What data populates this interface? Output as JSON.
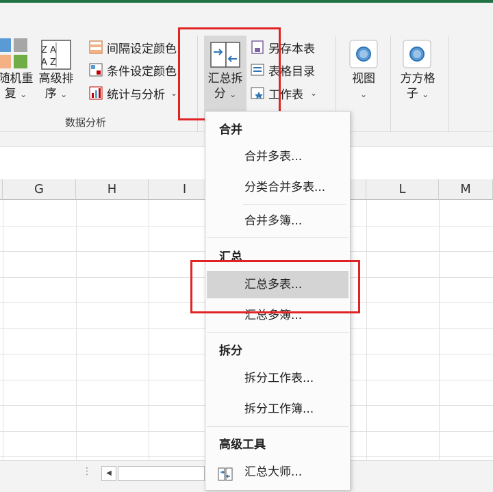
{
  "ribbon": {
    "random_label_1": "随机重",
    "random_label_2": "复",
    "sort_label_1": "高级排",
    "sort_label_2": "序",
    "interval_color": "间隔设定颜色",
    "condition_color": "条件设定颜色",
    "stats_analysis": "统计与分析",
    "group_data_analysis": "数据分析",
    "merge_split_1": "汇总拆",
    "merge_split_2": "分",
    "save_sheet": "另存本表",
    "table_dir": "表格目录",
    "worksheet": "工作表",
    "view": "视图",
    "grid_1": "方方格",
    "grid_2": "子",
    "chevron": "⌄",
    "sort_glyph_top": "Z A",
    "sort_glyph_bottom": "A Z"
  },
  "sheet": {
    "columns": [
      "G",
      "H",
      "I",
      "L",
      "M"
    ]
  },
  "menu": {
    "sec_merge": "合并",
    "merge_multi_table": "合并多表...",
    "classify_merge": "分类合并多表...",
    "merge_multi_book": "合并多簿...",
    "sec_summary": "汇总",
    "summary_multi_table": "汇总多表...",
    "summary_multi_book": "汇总多簿...",
    "sec_split": "拆分",
    "split_sheet": "拆分工作表...",
    "split_book": "拆分工作簿...",
    "sec_advanced": "高级工具",
    "summary_master": "汇总大师..."
  },
  "colors": {
    "accent_green": "#217346",
    "highlight_red": "#e02424",
    "menu_highlight": "#d4d4d4"
  }
}
